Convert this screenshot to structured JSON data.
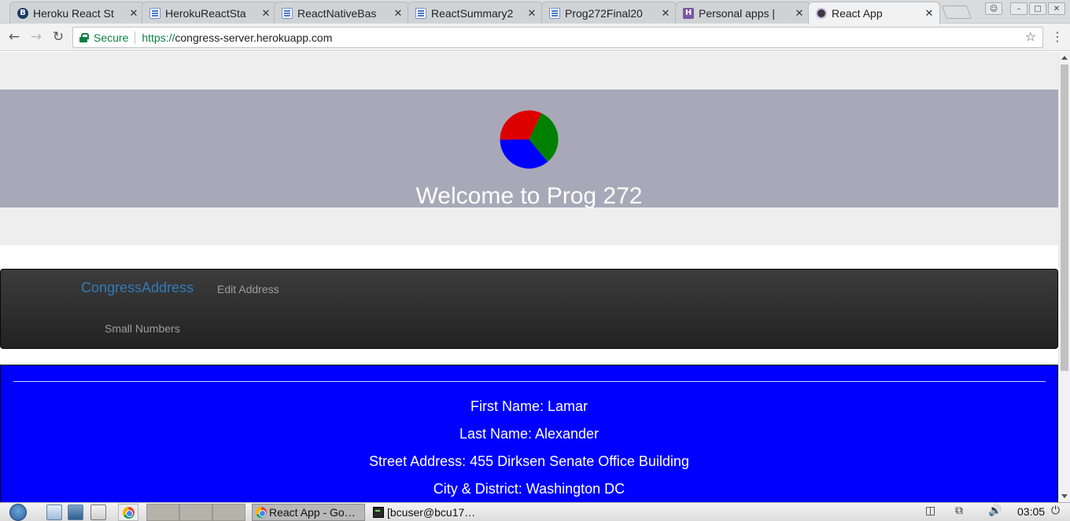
{
  "browser": {
    "tabs": [
      {
        "title": "Heroku React St",
        "icon": "heroku-b-icon",
        "active": false
      },
      {
        "title": "HerokuReactSta",
        "icon": "doc-icon",
        "active": false
      },
      {
        "title": "ReactNativeBas",
        "icon": "doc-icon",
        "active": false
      },
      {
        "title": "ReactSummary2",
        "icon": "doc-icon",
        "active": false
      },
      {
        "title": "Prog272Final20",
        "icon": "doc-icon",
        "active": false
      },
      {
        "title": "Personal apps |",
        "icon": "heroku-h-icon",
        "active": false
      },
      {
        "title": "React App",
        "icon": "react-icon",
        "active": true
      }
    ],
    "close_glyph": "✕",
    "secure_label": "Secure",
    "url_scheme": "https://",
    "url_host": "congress-server.herokuapp.com"
  },
  "page": {
    "welcome_title": "Welcome to Prog 272",
    "logo_slices": [
      {
        "color": "#008000",
        "fraction": 0.32
      },
      {
        "color": "#0000ff",
        "fraction": 0.36
      },
      {
        "color": "#dd0000",
        "fraction": 0.32
      }
    ],
    "navbar": {
      "brand": "CongressAddress",
      "links": [
        "Edit Address",
        "Small Numbers"
      ]
    },
    "address": {
      "first_name": "First Name: Lamar",
      "last_name": "Last Name: Alexander",
      "street": "Street Address: 455 Dirksen Senate Office Building",
      "city": "City & District: Washington DC"
    }
  },
  "taskbar": {
    "tasks": [
      {
        "label": "React App - Go…",
        "icon": "chrome-icon",
        "active": true
      },
      {
        "label": "[bcuser@bcu17…",
        "icon": "terminal-icon",
        "active": false
      }
    ],
    "clock": "03:05"
  },
  "colors": {
    "hero_bg": "#a9a8b8",
    "jumbotron_bg": "#eeeeee",
    "brand_link": "#337ab7",
    "address_bg": "#0000ff"
  }
}
